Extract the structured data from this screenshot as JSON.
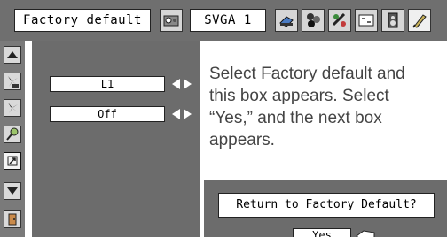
{
  "menubar": {
    "mode_label": "Factory default",
    "signal_label": "SVGA 1",
    "icons": [
      "factory-default-icon",
      "input-icon",
      "fan-settings-icon",
      "image-adjust-icon",
      "screen-icon",
      "audio-icon",
      "setting-icon"
    ]
  },
  "sidebar": {
    "icons": [
      "scroll-up-icon",
      "fan-off-icon",
      "fan-icon",
      "pin-icon",
      "factory-reset-icon",
      "scroll-down-icon",
      "exit-door-icon"
    ],
    "active_index": 4
  },
  "settings": {
    "row1_value": "L1",
    "row2_value": "Off"
  },
  "description": "Select Factory default and\nthis box appears.  Select\n“Yes,” and the next box\nappears.",
  "dialog": {
    "message": "Return to Factory Default?",
    "yes_label": "Yes"
  },
  "colors": {
    "bar": "#6f6f6f",
    "panel": "#6c6c6c",
    "description_text": "#444444"
  }
}
